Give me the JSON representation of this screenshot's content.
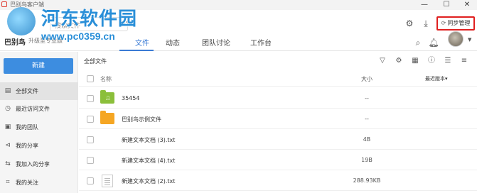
{
  "window": {
    "title": "巴别鸟客户端",
    "minimize": "—",
    "maximize": "☐",
    "close": "✕"
  },
  "watermark": {
    "title": "河东软件园",
    "url": "www.pc0359.cn"
  },
  "header": {
    "search_placeholder": "搜索文件",
    "plus": "+",
    "sync_label": "同步管理",
    "brand": "巴别鸟",
    "brand_sub": "升级至专业版",
    "tabs": [
      {
        "label": "文件",
        "active": true
      },
      {
        "label": "动态",
        "active": false
      },
      {
        "label": "团队讨论",
        "active": false
      },
      {
        "label": "工作台",
        "active": false
      }
    ]
  },
  "sidebar": {
    "new_button": "新建",
    "items": [
      {
        "label": "全部文件",
        "icon": "all-files-icon",
        "active": true
      },
      {
        "label": "最近访问文件",
        "icon": "recent-icon",
        "active": false
      },
      {
        "label": "我的团队",
        "icon": "team-icon",
        "active": false
      },
      {
        "label": "我的分享",
        "icon": "share-icon",
        "active": false
      },
      {
        "label": "我加入的分享",
        "icon": "joined-share-icon",
        "active": false
      },
      {
        "label": "我的关注",
        "icon": "follow-icon",
        "active": false
      }
    ]
  },
  "main": {
    "breadcrumb": "全部文件",
    "columns": {
      "name": "名称",
      "size": "大小",
      "version": "最近版本▾"
    },
    "rows": [
      {
        "name": "35454",
        "size": "--",
        "type": "folder-green"
      },
      {
        "name": "巴别鸟示例文件",
        "size": "--",
        "type": "folder-orange"
      },
      {
        "name": "新建文本文档 (3).txt",
        "size": "4B",
        "type": "txt"
      },
      {
        "name": "新建文本文档 (4).txt",
        "size": "19B",
        "type": "txt"
      },
      {
        "name": "新建文本文档 (2).txt",
        "size": "288.93KB",
        "type": "doc"
      }
    ]
  },
  "colors": {
    "accent": "#3a7bd5",
    "new_button": "#3d8de0",
    "sync_border": "#e02020"
  }
}
